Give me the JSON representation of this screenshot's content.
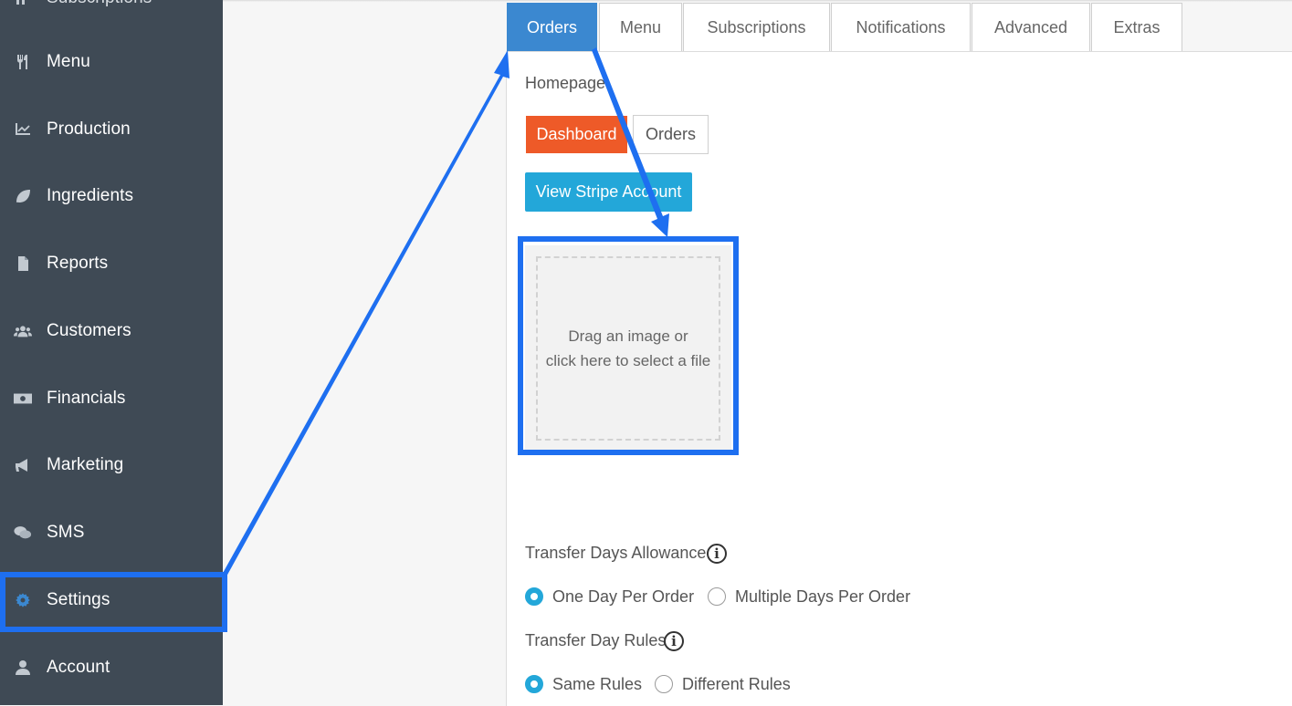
{
  "sidebar": {
    "items": [
      {
        "label": "Subscriptions",
        "icon": "subscriptions-icon"
      },
      {
        "label": "Menu",
        "icon": "utensils-icon"
      },
      {
        "label": "Production",
        "icon": "chart-line-icon"
      },
      {
        "label": "Ingredients",
        "icon": "leaf-icon"
      },
      {
        "label": "Reports",
        "icon": "file-icon"
      },
      {
        "label": "Customers",
        "icon": "users-icon"
      },
      {
        "label": "Financials",
        "icon": "money-icon"
      },
      {
        "label": "Marketing",
        "icon": "bullhorn-icon"
      },
      {
        "label": "SMS",
        "icon": "comments-icon"
      },
      {
        "label": "Settings",
        "icon": "gear-icon"
      },
      {
        "label": "Account",
        "icon": "user-icon"
      }
    ],
    "active": "Settings"
  },
  "tabs": [
    "Orders",
    "Menu",
    "Subscriptions",
    "Notifications",
    "Advanced",
    "Extras"
  ],
  "active_tab": "Orders",
  "homepage": {
    "label": "Homepage",
    "options": [
      "Dashboard",
      "Orders"
    ],
    "selected": "Dashboard"
  },
  "stripe_button": "View Stripe Account",
  "dropzone": {
    "line1": "Drag an image or",
    "line2": "click here to select a file"
  },
  "transfer_days_allowance": {
    "label": "Transfer Days Allowance",
    "options": [
      "One Day Per Order",
      "Multiple Days Per Order"
    ],
    "selected": "One Day Per Order"
  },
  "transfer_day_rules": {
    "label": "Transfer Day Rules",
    "options": [
      "Same Rules",
      "Different Rules"
    ],
    "selected": "Same Rules"
  },
  "colors": {
    "sidebar_bg": "#3f4a55",
    "accent_blue": "#3b88d0",
    "orange": "#ee5a28",
    "cyan": "#23a7d9",
    "highlight": "#1e6ff0"
  }
}
